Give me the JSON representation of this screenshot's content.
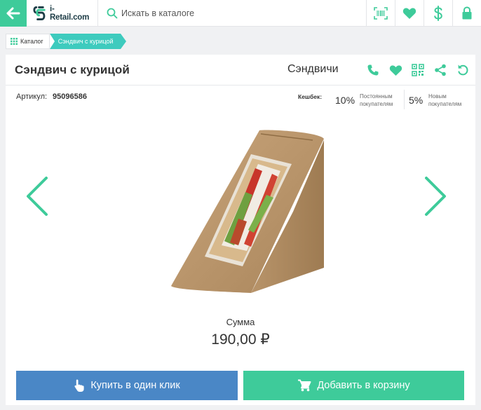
{
  "header": {
    "logo_text": "i-Retail.com",
    "search_placeholder": "Искать в каталоге"
  },
  "breadcrumb": {
    "catalog": "Каталог",
    "current": "Сэндвич с курицой"
  },
  "product": {
    "title": "Сэндвич с курицой",
    "category": "Сэндвичи",
    "sku_label": "Артикул:",
    "sku": "95096586",
    "cashback_label": "Кешбек:",
    "cashback": [
      {
        "percent": "10%",
        "text": "Постоянным покупателям"
      },
      {
        "percent": "5%",
        "text": "Новым покупателям"
      }
    ],
    "sum_label": "Сумма",
    "price": "190,00 ₽"
  },
  "buttons": {
    "buy_one_click": "Купить в один клик",
    "add_to_cart": "Добавить в корзину"
  },
  "colors": {
    "accent": "#3ecb9a",
    "breadcrumb": "#3ecbbe",
    "buy_button": "#4a87c6"
  }
}
